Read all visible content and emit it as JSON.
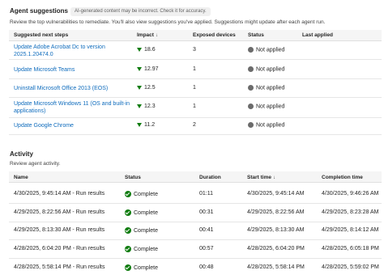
{
  "suggestions": {
    "title": "Agent suggestions",
    "badge": "AI-generated content may be incorrect. Check it for accuracy.",
    "description": "Review the top vulnerabilities to remediate. You'll also view suggestions you've applied. Suggestions might update after each agent run.",
    "columns": {
      "next_steps": "Suggested next steps",
      "impact": "Impact",
      "exposed": "Exposed devices",
      "status": "Status",
      "last_applied": "Last applied"
    },
    "sort_icon": "arrow-down-icon",
    "rows": [
      {
        "step": "Update Adobe Acrobat Dc to version 2025.1.20474.0",
        "impact": "18.6",
        "exposed": "3",
        "status": "Not applied",
        "last_applied": ""
      },
      {
        "step": "Update Microsoft Teams",
        "impact": "12.97",
        "exposed": "1",
        "status": "Not applied",
        "last_applied": ""
      },
      {
        "step": "Uninstall Microsoft Office 2013 (EOS)",
        "impact": "12.5",
        "exposed": "1",
        "status": "Not applied",
        "last_applied": ""
      },
      {
        "step": "Update Microsoft Windows 11 (OS and built-in applications)",
        "impact": "12.3",
        "exposed": "1",
        "status": "Not applied",
        "last_applied": ""
      },
      {
        "step": "Update Google Chrome",
        "impact": "11.2",
        "exposed": "2",
        "status": "Not applied",
        "last_applied": ""
      }
    ]
  },
  "activity": {
    "title": "Activity",
    "description": "Review agent activity.",
    "columns": {
      "name": "Name",
      "status": "Status",
      "duration": "Duration",
      "start": "Start time",
      "completion": "Completion time"
    },
    "rows": [
      {
        "name": "4/30/2025, 9:45:14 AM - Run results",
        "status": "Complete",
        "duration": "01:11",
        "start": "4/30/2025, 9:45:14 AM",
        "completion": "4/30/2025, 9:46:26 AM"
      },
      {
        "name": "4/29/2025, 8:22:56 AM - Run results",
        "status": "Complete",
        "duration": "00:31",
        "start": "4/29/2025, 8:22:56 AM",
        "completion": "4/29/2025, 8:23:28 AM"
      },
      {
        "name": "4/29/2025, 8:13:30 AM - Run results",
        "status": "Complete",
        "duration": "00:41",
        "start": "4/29/2025, 8:13:30 AM",
        "completion": "4/29/2025, 8:14:12 AM"
      },
      {
        "name": "4/28/2025, 6:04:20 PM - Run results",
        "status": "Complete",
        "duration": "00:57",
        "start": "4/28/2025, 6:04:20 PM",
        "completion": "4/28/2025, 6:05:18 PM"
      },
      {
        "name": "4/28/2025, 5:58:14 PM - Run results",
        "status": "Complete",
        "duration": "00:48",
        "start": "4/28/2025, 5:58:14 PM",
        "completion": "4/28/2025, 5:59:02 PM"
      }
    ]
  }
}
